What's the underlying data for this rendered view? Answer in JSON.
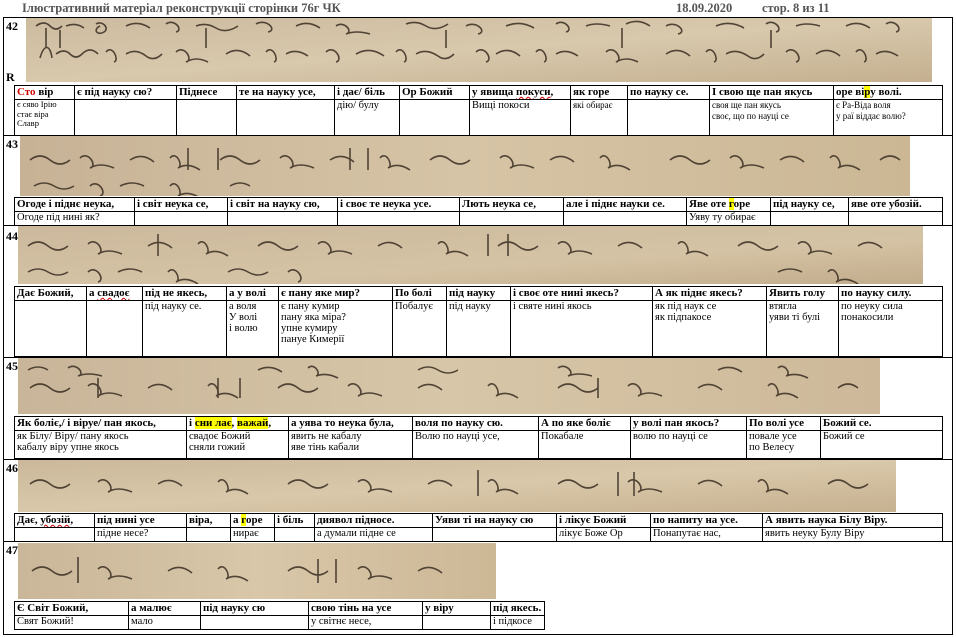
{
  "header": {
    "title": "Ілюстративний матеріал  реконструкції сторінки 76г ЧК",
    "date": "18.09.2020",
    "page": "стор. 8 из 11"
  },
  "lines": [
    {
      "num": "42",
      "marker": "R",
      "headers": [
        "Сто вір",
        "є під науку сю?",
        "Піднесе",
        "те на науку усе,",
        "і дає/ біль",
        "Ор Божий",
        "у явища покуси,",
        "як горе",
        "по науку се.",
        "І свою ще пан якусь",
        "оре віру волі."
      ],
      "subs": [
        "є сяво Ірію\nстає віра\nСлавр",
        "",
        "",
        "",
        "дію/ булу",
        "",
        "Вищі покоси",
        "які обирає",
        "",
        "своя ще пан якусь\nсвоє, що по науці се",
        "є Ра-Віда воля\nу раї віддає волю?"
      ]
    },
    {
      "num": "43",
      "headers": [
        "Огоде і піднє неука,",
        "і світ неука се,",
        "і світ на науку сю,",
        "і своє те неука усе.",
        "Лють неука се,",
        "але і піднє науки се.",
        "Яве оте горе",
        "під науку се,",
        "яве оте убозій."
      ],
      "subs": [
        "Огоде під нині як?",
        "",
        "",
        "",
        "",
        "",
        "Уяву ту обирає",
        "",
        ""
      ]
    },
    {
      "num": "44",
      "headers": [
        "Дає Божий,",
        "а свадоє",
        "під не якесь,",
        "а у волі",
        "є пану яке мир?",
        "По болі",
        "під науку",
        "і своє оте нині якесь?",
        "А як піднє якесь?",
        "Явить голу",
        "по науку силу."
      ],
      "subs": [
        "",
        "",
        "під науку се.",
        "а воля\nУ волі\nі волю",
        "є пану кумир\nпану яка міра?\nупне кумиру\nпануе Кимерії",
        "Побалує",
        "під науку",
        "і святе нині якось",
        "як під наук се\nяк підпакосе",
        "втягла\nуяви ті булі",
        "по неуку сила\nпонакосили"
      ]
    },
    {
      "num": "45",
      "headers": [
        "Як боліє,/ і віруе/ пан якось,",
        "і сни лає, важай,",
        "а уява то неука була,",
        "воля по науку сю.",
        "А по яке боліє",
        "у волі пан якось?",
        "По волі усе",
        "Божий се."
      ],
      "subs": [
        "як Білу/ Віру/ пану якось\nкабалу віру упне якось",
        "свадоє Божий\nсняли гожий",
        "явить не кабалу\nяве тінь кабали",
        "Волю по науці усе,",
        "Покабале",
        "волю по науці се",
        "повале усе\nпо Велесу",
        "Божий се"
      ]
    },
    {
      "num": "46",
      "headers": [
        "Дає, убозій,",
        "під нині усе",
        "віра,",
        "а горе",
        "і біль",
        "диявол підносе.",
        "Уяви ті на науку сю",
        "і лікує Божий",
        "по напиту на усе.",
        "А явить наука Білу Віру."
      ],
      "subs": [
        "",
        "підне несе?",
        "",
        "нирає",
        "",
        "а думали підне се",
        "",
        "лікує Боже Ор",
        "Понапутає нас,",
        "явить неуку Булу Віру"
      ]
    },
    {
      "num": "47",
      "headers": [
        "Є Світ Божий,",
        "а малює",
        "під науку сю",
        "свою тінь на усе",
        "у віру",
        "під якесь."
      ],
      "subs": [
        "Свят Божий!",
        "мало",
        "",
        "у світнє несе,",
        "",
        "і підкосе"
      ]
    }
  ]
}
